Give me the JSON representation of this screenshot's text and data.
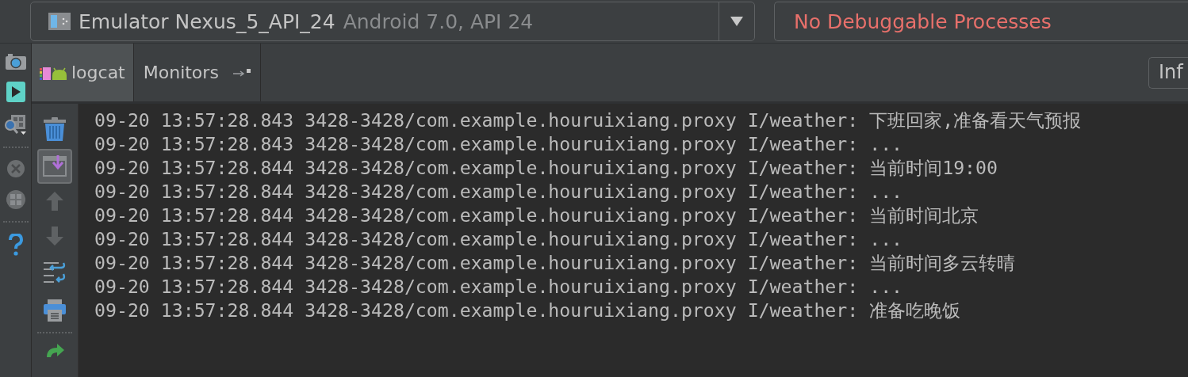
{
  "device_selector": {
    "name": "Emulator Nexus_5_API_24",
    "detail": "Android 7.0, API 24"
  },
  "process_selector": {
    "value": "No Debuggable Processes"
  },
  "tabs": [
    {
      "label": "logcat",
      "selected": true
    },
    {
      "label": "Monitors",
      "selected": false
    }
  ],
  "log_level": {
    "value": "Inf"
  },
  "scroll_to_end": {
    "on": true
  },
  "log_lines": [
    "09-20 13:57:28.843 3428-3428/com.example.houruixiang.proxy I/weather: 下班回家,准备看天气预报",
    "09-20 13:57:28.843 3428-3428/com.example.houruixiang.proxy I/weather: ...",
    "09-20 13:57:28.844 3428-3428/com.example.houruixiang.proxy I/weather: 当前时间19:00",
    "09-20 13:57:28.844 3428-3428/com.example.houruixiang.proxy I/weather: ...",
    "09-20 13:57:28.844 3428-3428/com.example.houruixiang.proxy I/weather: 当前时间北京",
    "09-20 13:57:28.844 3428-3428/com.example.houruixiang.proxy I/weather: ...",
    "09-20 13:57:28.844 3428-3428/com.example.houruixiang.proxy I/weather: 当前时间多云转晴",
    "09-20 13:57:28.844 3428-3428/com.example.houruixiang.proxy I/weather: ...",
    "09-20 13:57:28.844 3428-3428/com.example.houruixiang.proxy I/weather: 准备吃晚饭"
  ]
}
